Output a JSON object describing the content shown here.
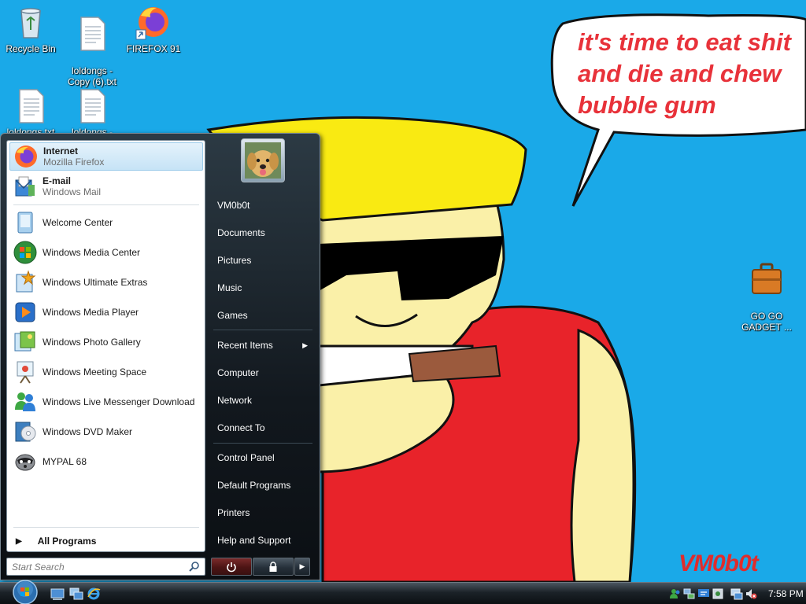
{
  "desktop": {
    "icons": [
      {
        "label": "Recycle Bin"
      },
      {
        "label": "loldongs -\nCopy (6).txt"
      },
      {
        "label": "FIREFOX 91"
      },
      {
        "label": "loldongs.txt"
      },
      {
        "label": "loldongs -"
      },
      {
        "label": "GO GO\nGADGET ..."
      }
    ],
    "wallpaper": {
      "speech_text": "it's time to eat shit\nand die and chew\nbubble gum",
      "signature": "VM0b0t"
    }
  },
  "start_menu": {
    "pinned": [
      {
        "name": "Internet",
        "sub": "Mozilla Firefox",
        "icon": "firefox-icon"
      },
      {
        "name": "E-mail",
        "sub": "Windows Mail",
        "icon": "mail-icon"
      }
    ],
    "recent": [
      {
        "name": "Welcome Center",
        "icon": "welcome-center-icon"
      },
      {
        "name": "Windows Media Center",
        "icon": "media-center-icon"
      },
      {
        "name": "Windows Ultimate Extras",
        "icon": "ultimate-extras-icon"
      },
      {
        "name": "Windows Media Player",
        "icon": "media-player-icon"
      },
      {
        "name": "Windows Photo Gallery",
        "icon": "photo-gallery-icon"
      },
      {
        "name": "Windows Meeting Space",
        "icon": "meeting-space-icon"
      },
      {
        "name": "Windows Live Messenger Download",
        "icon": "messenger-icon"
      },
      {
        "name": "Windows DVD Maker",
        "icon": "dvd-maker-icon"
      },
      {
        "name": "MYPAL 68",
        "icon": "mypal-icon"
      }
    ],
    "all_programs": "All Programs",
    "search_placeholder": "Start Search",
    "right_items": [
      {
        "label": "VM0b0t"
      },
      {
        "label": "Documents"
      },
      {
        "label": "Pictures"
      },
      {
        "label": "Music"
      },
      {
        "label": "Games"
      },
      {
        "label": "Recent Items"
      },
      {
        "label": "Computer"
      },
      {
        "label": "Network"
      },
      {
        "label": "Connect To"
      },
      {
        "label": "Control Panel"
      },
      {
        "label": "Default Programs"
      },
      {
        "label": "Printers"
      },
      {
        "label": "Help and Support"
      }
    ]
  },
  "taskbar": {
    "clock": "7:58 PM"
  }
}
